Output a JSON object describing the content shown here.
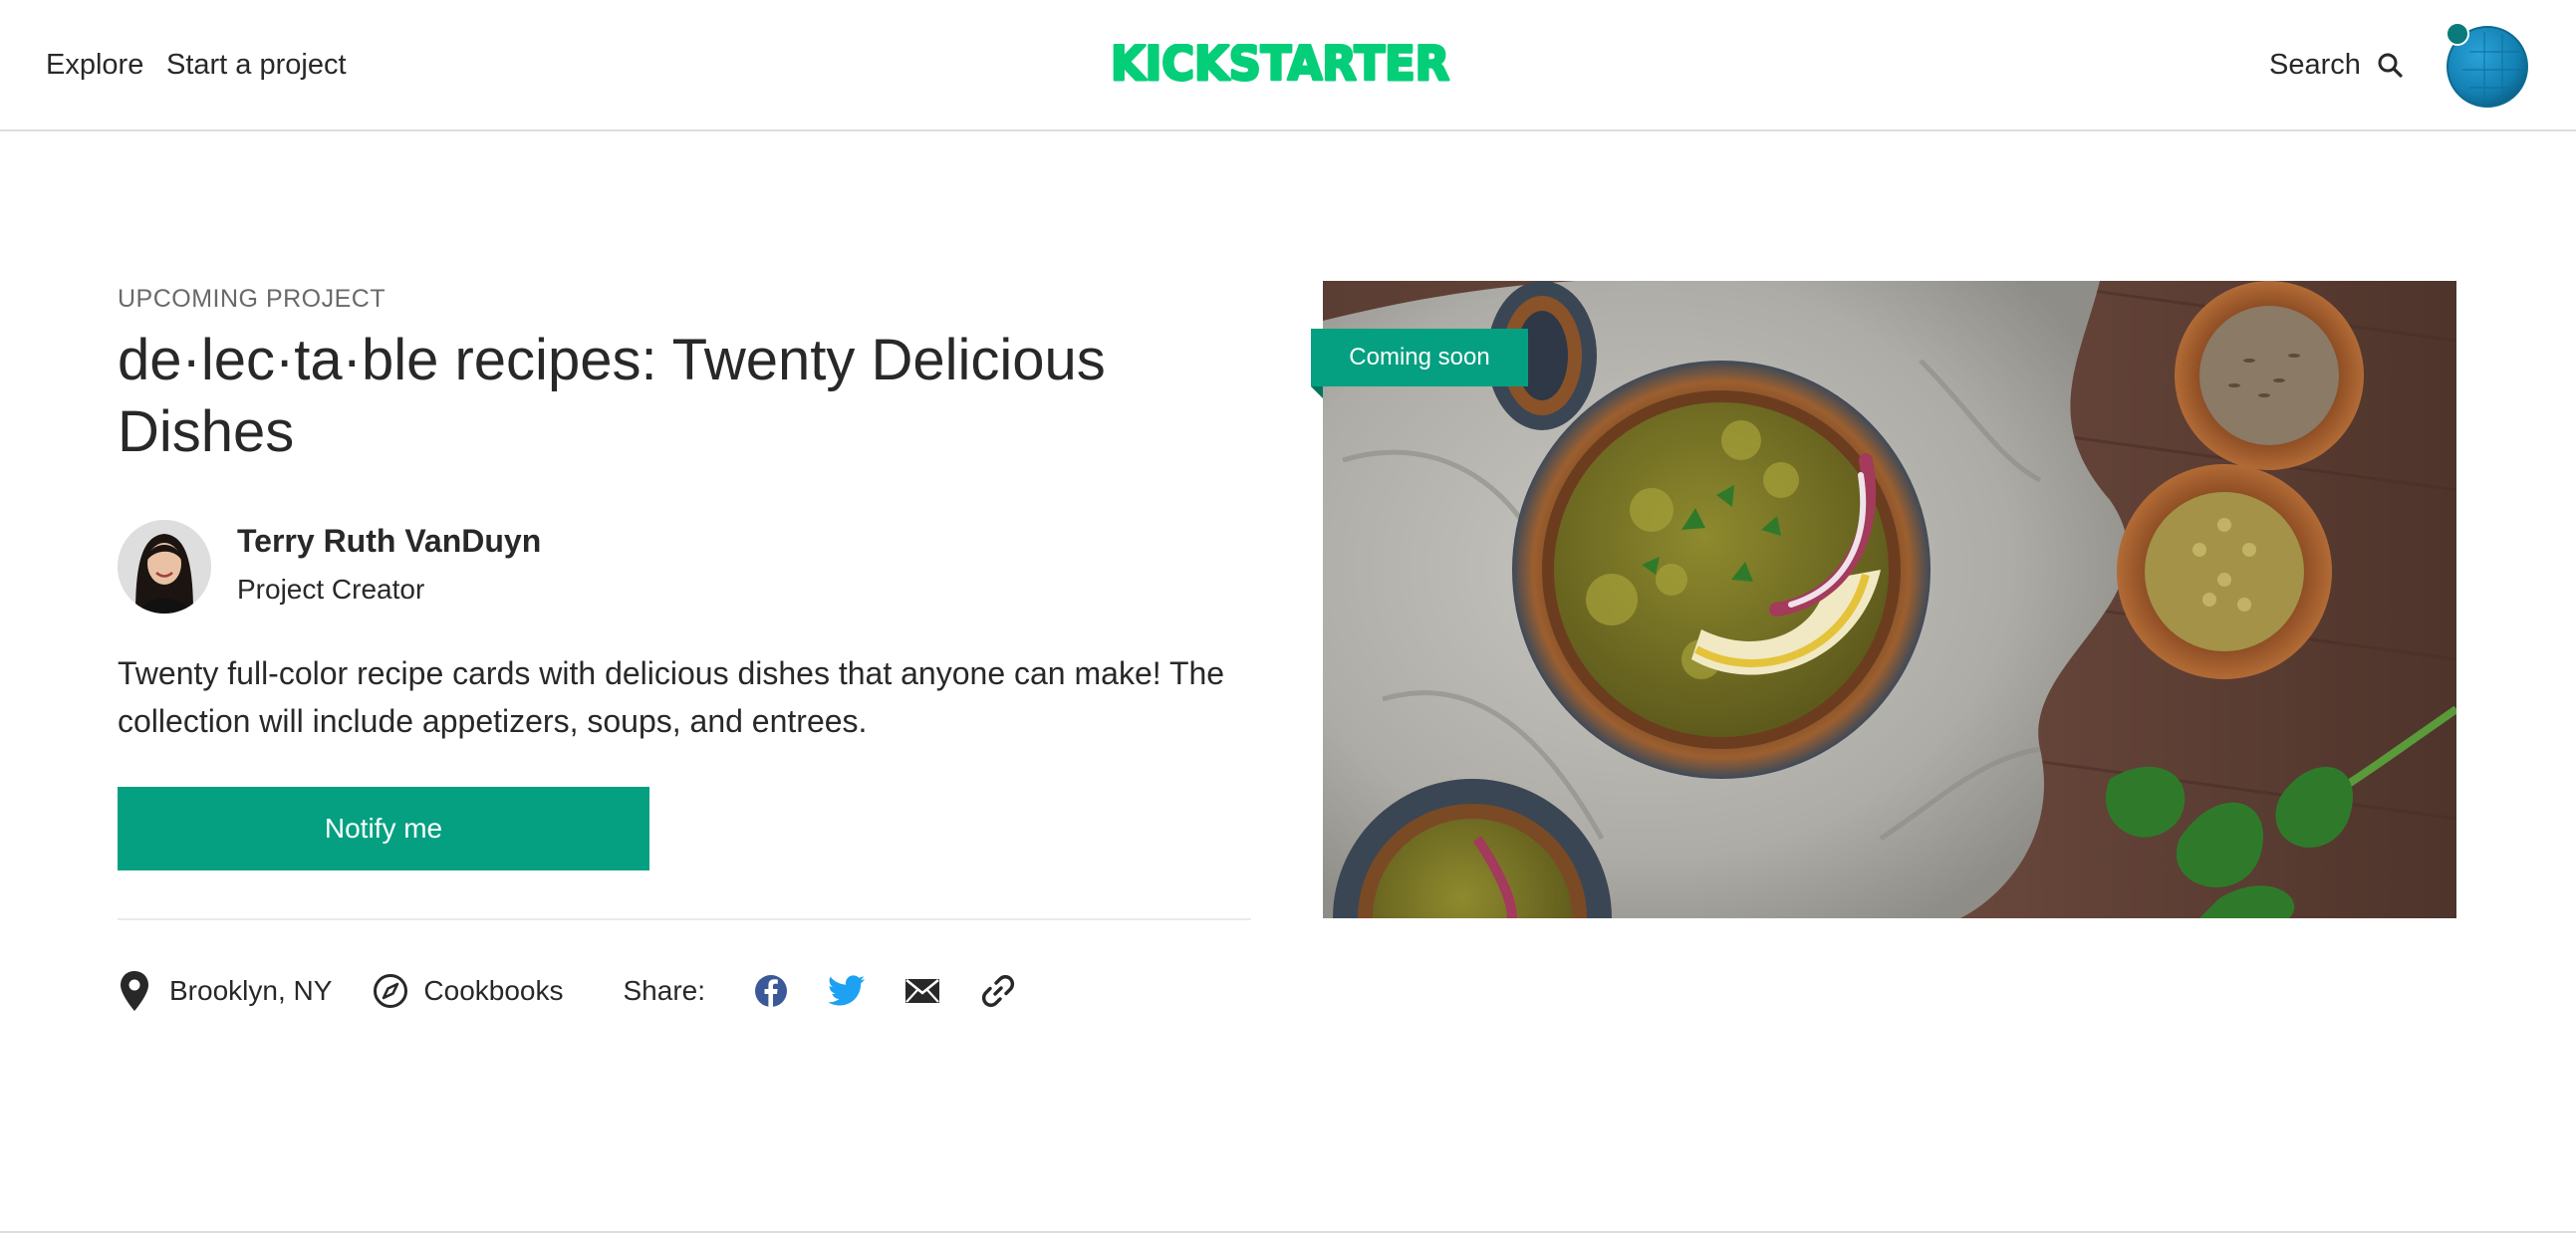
{
  "header": {
    "nav": [
      "Explore",
      "Start a project"
    ],
    "logo": "KICKSTARTER",
    "search_label": "Search"
  },
  "project": {
    "eyebrow": "UPCOMING PROJECT",
    "title": "de·lec·ta·ble recipes: Twenty Delicious Dishes",
    "creator_name": "Terry Ruth VanDuyn",
    "creator_role": "Project Creator",
    "blurb": "Twenty full-color recipe cards with delicious dishes that anyone can make! The collection will include appetizers, soups, and entrees.",
    "notify_label": "Notify me",
    "location": "Brooklyn, NY",
    "category": "Cookbooks",
    "share_label": "Share:",
    "badge": "Coming soon"
  },
  "colors": {
    "brand_green": "#05ce78",
    "accent_teal": "#05a081",
    "facebook": "#3b5998",
    "twitter": "#1da1f2"
  },
  "icons": [
    "search-icon",
    "avatar",
    "location-pin-icon",
    "compass-icon",
    "facebook-icon",
    "twitter-icon",
    "email-icon",
    "link-icon"
  ]
}
